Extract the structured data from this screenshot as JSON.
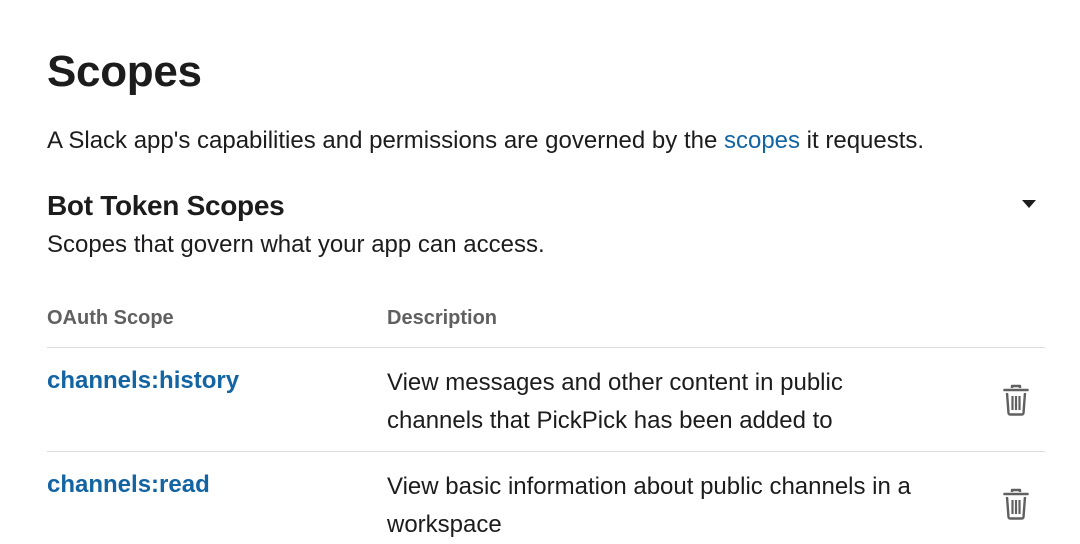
{
  "header": {
    "title": "Scopes",
    "intro_before": "A Slack app's capabilities and permissions are governed by the ",
    "intro_link": "scopes",
    "intro_after": " it requests."
  },
  "bot_section": {
    "title": "Bot Token Scopes",
    "description": "Scopes that govern what your app can access.",
    "toggle_icon": "caret-down-icon"
  },
  "table": {
    "columns": [
      "OAuth Scope",
      "Description"
    ],
    "rows": [
      {
        "scope": "channels:history",
        "description": "View messages and other content in public channels that PickPick has been added to",
        "action_icon": "trash-icon"
      },
      {
        "scope": "channels:read",
        "description": "View basic information about public channels in a workspace",
        "action_icon": "trash-icon"
      }
    ]
  },
  "colors": {
    "link": "#1264a3",
    "text": "#1d1c1d",
    "muted": "#616061",
    "divider": "#dddddd"
  }
}
